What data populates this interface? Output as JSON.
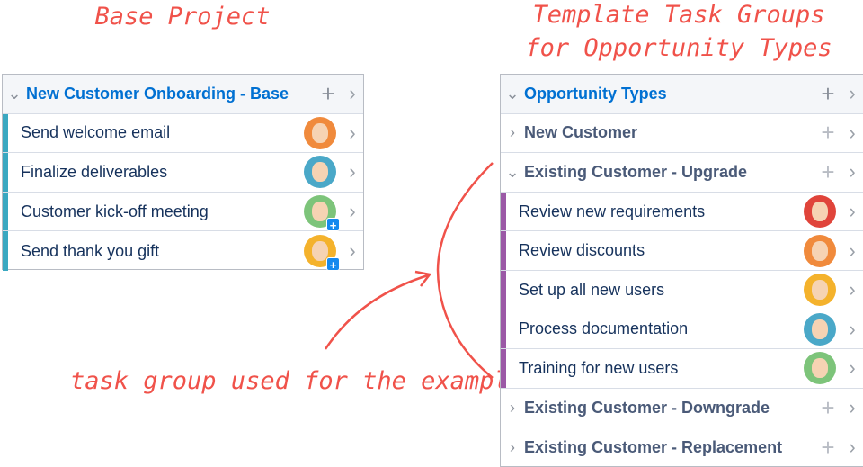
{
  "annotations": {
    "base_title": "Base Project",
    "template_title_1": "Template Task Groups",
    "template_title_2": "for Opportunity Types",
    "arrow_label": "task group used for the example",
    "color": "#f0524a"
  },
  "base_panel": {
    "title": "New Customer Onboarding - Base",
    "accent": "#3aa8c1",
    "tasks": [
      {
        "label": "Send welcome email",
        "avatar": "#f08a3c",
        "badge": false
      },
      {
        "label": "Finalize deliverables",
        "avatar": "#4aa8c8",
        "badge": false
      },
      {
        "label": "Customer kick-off meeting",
        "avatar": "#7dc47a",
        "badge": true
      },
      {
        "label": "Send thank you gift",
        "avatar": "#f4b22c",
        "badge": true
      }
    ]
  },
  "template_panel": {
    "title": "Opportunity Types",
    "accent": "#9b59a6",
    "groups": [
      {
        "label": "New Customer",
        "expanded": false
      },
      {
        "label": "Existing Customer - Upgrade",
        "expanded": true
      },
      {
        "label": "Existing Customer - Downgrade",
        "expanded": false
      },
      {
        "label": "Existing Customer - Replacement",
        "expanded": false
      }
    ],
    "tasks": [
      {
        "label": "Review new requirements",
        "avatar": "#e0443a"
      },
      {
        "label": "Review discounts",
        "avatar": "#f08a3c"
      },
      {
        "label": "Set up all new users",
        "avatar": "#f4b22c"
      },
      {
        "label": "Process documentation",
        "avatar": "#4aa8c8"
      },
      {
        "label": "Training for new users",
        "avatar": "#7dc47a"
      }
    ]
  },
  "icons": {
    "expand": "chevron-down-icon",
    "collapse": "chevron-right-icon",
    "add": "plus-icon",
    "open": "chevron-right-icon",
    "badge": "plus-badge-icon"
  }
}
